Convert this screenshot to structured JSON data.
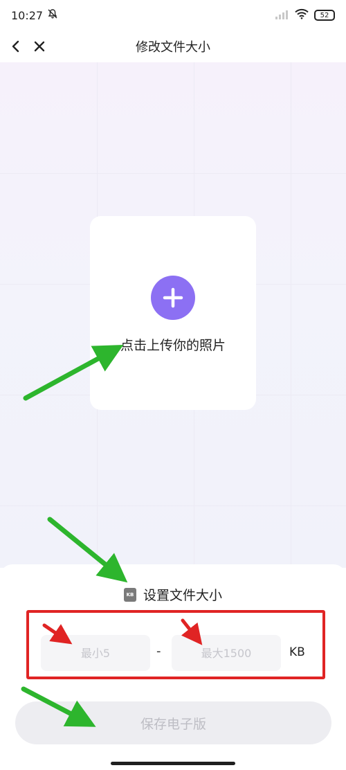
{
  "status_bar": {
    "time": "10:27",
    "battery": "52"
  },
  "nav": {
    "title": "修改文件大小"
  },
  "upload": {
    "label": "点击上传你的照片"
  },
  "size_section": {
    "icon_text": "KB",
    "title": "设置文件大小",
    "min_placeholder": "最小5",
    "max_placeholder": "最大1500",
    "separator": "-",
    "unit": "KB"
  },
  "save_button": {
    "label": "保存电子版"
  },
  "colors": {
    "accent": "#8c70f3",
    "annotation_red": "#e02424",
    "annotation_green": "#2db52d",
    "button_disabled": "#ededf1"
  },
  "icons": [
    "bell-off-icon",
    "signal-icon",
    "wifi-icon",
    "battery-icon",
    "back-chevron-icon",
    "close-icon",
    "plus-icon",
    "kb-file-icon"
  ]
}
